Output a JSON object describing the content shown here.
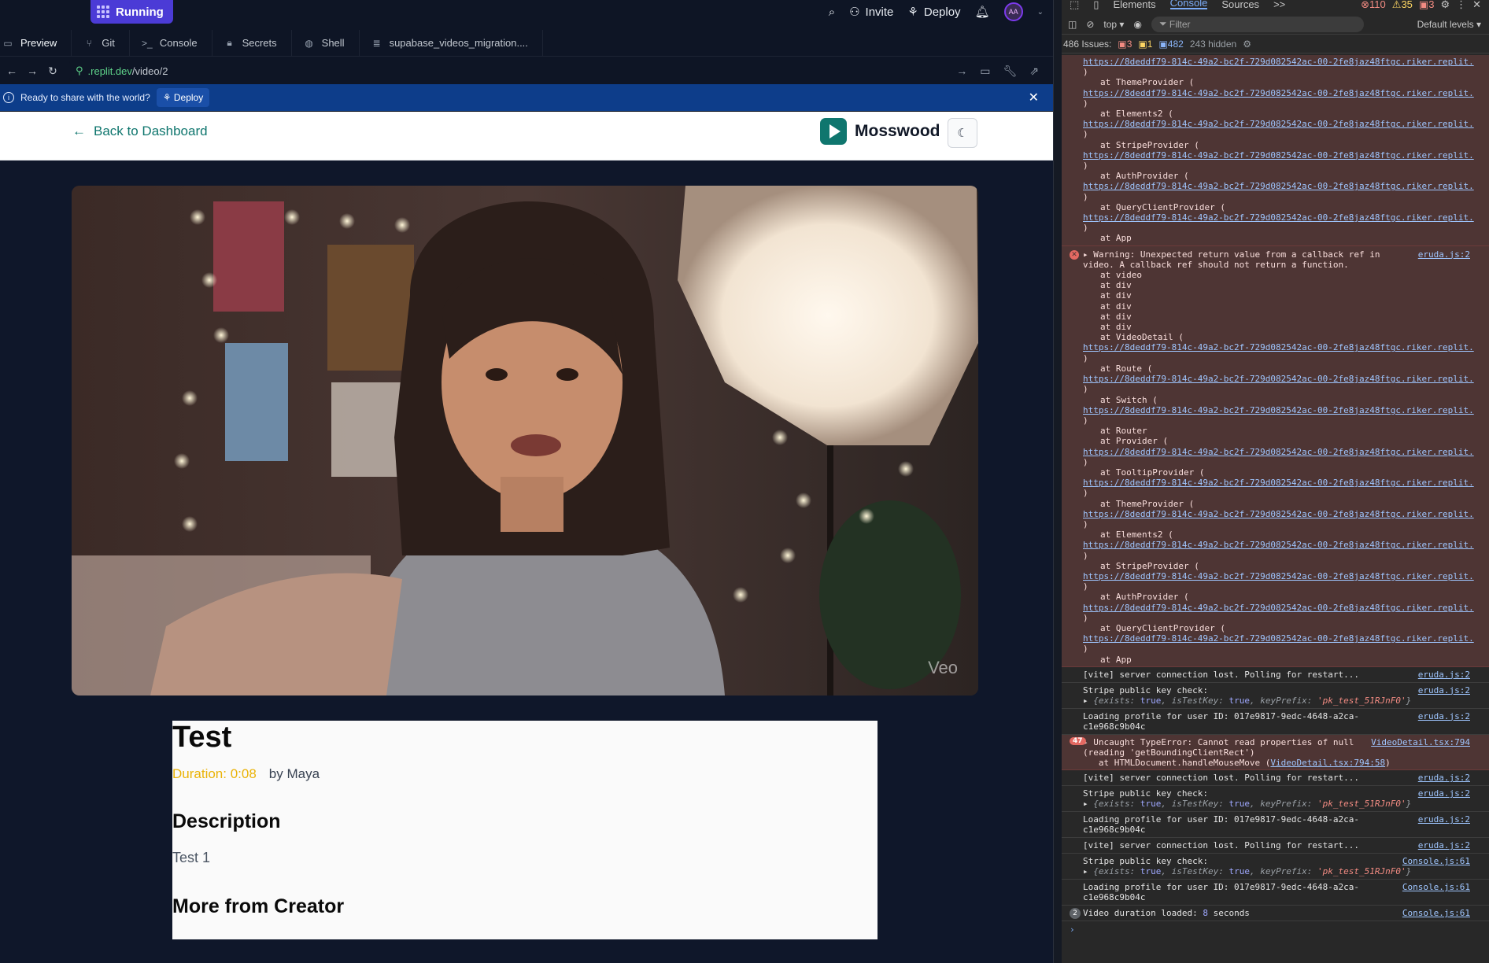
{
  "topbar": {
    "status_label": "Running",
    "invite_label": "Invite",
    "deploy_label": "Deploy",
    "avatar_initials": "AA"
  },
  "tabs": [
    {
      "label": "Preview",
      "icon": "monitor-icon"
    },
    {
      "label": "Git",
      "icon": "git-icon"
    },
    {
      "label": "Console",
      "icon": "terminal-icon"
    },
    {
      "label": "Secrets",
      "icon": "lock-icon"
    },
    {
      "label": "Shell",
      "icon": "shell-icon"
    },
    {
      "label": "supabase_videos_migration....",
      "icon": "database-icon"
    }
  ],
  "urlbar": {
    "host": ".replit.dev",
    "path": "/video/2"
  },
  "banner": {
    "text": "Ready to share with the world?",
    "deploy_label": "Deploy"
  },
  "app": {
    "back_label": "Back to Dashboard",
    "brand_name": "Mosswood",
    "video_watermark": "Veo",
    "video_title": "Test",
    "duration": "Duration: 0:08",
    "author": "by Maya",
    "description_heading": "Description",
    "description": "Test 1",
    "more_heading": "More from Creator"
  },
  "devtools": {
    "tabs": [
      "Elements",
      "Console",
      "Sources",
      ">>"
    ],
    "active_tab": "Console",
    "counts": {
      "errors": "110",
      "warnings": "35",
      "issues": "3"
    },
    "context": "top",
    "filter_placeholder": "Filter",
    "levels": "Default levels",
    "issues_label": "486 Issues:",
    "issues_errors": "3",
    "issues_warnings": "1",
    "issues_info": "482",
    "hidden": "243 hidden",
    "url": "https://8deddf79-814c-49a2-bc2f-729d082542ac-00-2fe8jaz48ftgc.riker.replit.",
    "stack_top": [
      "at ThemeProvider (",
      "at Elements2 (",
      "at StripeProvider (",
      "at AuthProvider (",
      "at QueryClientProvider ("
    ],
    "warning_line1": "Warning: Unexpected return value from a callback ref in",
    "warning_line2": "video. A callback ref should not return a function.",
    "warning_src": "eruda.js:2",
    "warning_frames": [
      "at video",
      "at div",
      "at div",
      "at div",
      "at div",
      "at div"
    ],
    "stack_bottom": [
      "at VideoDetail (",
      "at Route (",
      "at Switch (",
      "at Router",
      "at Provider (",
      "at TooltipProvider (",
      "at ThemeProvider (",
      "at Elements2 (",
      "at StripeProvider (",
      "at AuthProvider (",
      "at QueryClientProvider ("
    ],
    "at_app": "at App",
    "vite_msg": "[vite] server connection lost. Polling for restart...",
    "stripe_msg": "Stripe public key check:",
    "stripe_obj_prefix": "{exists: ",
    "stripe_obj_true": "true",
    "stripe_obj_mid": ", isTestKey: ",
    "stripe_obj_kp": ", keyPrefix: ",
    "stripe_obj_key": "'pk_test_51RJnF0'",
    "stripe_obj_end": "}",
    "profile_msg1": "Loading profile for user ID: 017e9817-9edc-4648-a2ca-",
    "profile_msg2": "c1e968c9b04c",
    "err_count": "47",
    "type_error1": "Uncaught TypeError: Cannot read properties of null",
    "type_error2": "(reading 'getBoundingClientRect')",
    "type_error3": "at HTMLDocument.handleMouseMove (",
    "type_error_link": "VideoDetail.tsx:794:58",
    "type_error3_end": ")",
    "type_error_src": "VideoDetail.tsx:794",
    "src_eruda": "eruda.js:2",
    "src_console": "Console.js:61",
    "dup_count": "2",
    "video_loaded_prefix": "Video duration loaded: ",
    "video_loaded_num": "8",
    "video_loaded_suffix": " seconds"
  }
}
